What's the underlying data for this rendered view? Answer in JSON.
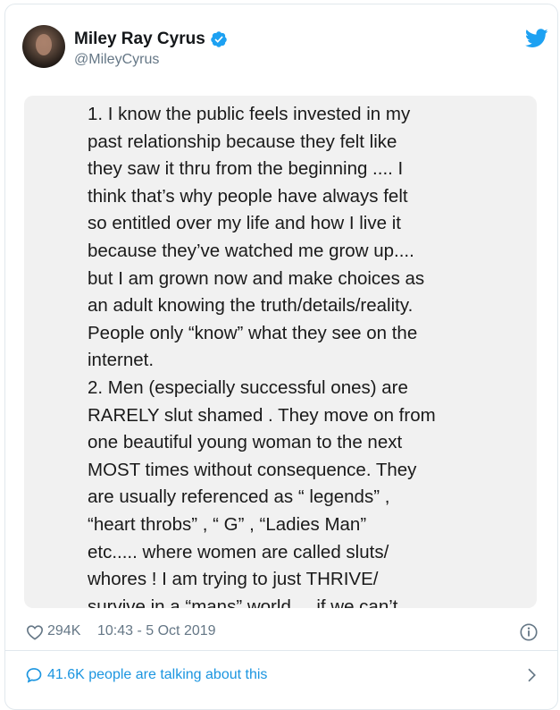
{
  "tweet": {
    "author": {
      "display_name": "Miley Ray Cyrus",
      "handle": "@MileyCyrus",
      "verified": true
    },
    "image_text_lines": [
      "1. I know the public feels invested in my",
      "past relationship because they felt like",
      "they saw it thru from the beginning .... I",
      "think that’s why people have always felt",
      "so entitled over my life and how I live it",
      "because they’ve watched me grow up....",
      "but I am grown now and make choices as",
      "an adult knowing the truth/details/reality.",
      "People only “know” what they see on the",
      "internet.",
      "2. Men (especially successful ones) are",
      "RARELY slut shamed . They move on from",
      "one beautiful young woman to the next",
      "MOST times without consequence. They",
      "are usually referenced as “ legends” ,",
      "“heart throbs” , “ G” , “Ladies Man”",
      "etc..... where women are called sluts/",
      "whores ! I am trying to just THRIVE/",
      "survive in a “mans” world ... if we can’t"
    ],
    "likes": "294K",
    "timestamp": "10:43 - 5 Oct 2019",
    "talking": "41.6K people are talking about this"
  },
  "icons": {
    "verified": "verified-badge-icon",
    "brand": "twitter-bird-icon",
    "like": "heart-outline-icon",
    "info": "info-icon",
    "reply": "speech-bubble-icon",
    "more": "chevron-right-icon"
  },
  "colors": {
    "brand": "#1da1f2",
    "link": "#1b95e0",
    "muted": "#657786",
    "text": "#14171a",
    "border": "#e1e8ed"
  }
}
